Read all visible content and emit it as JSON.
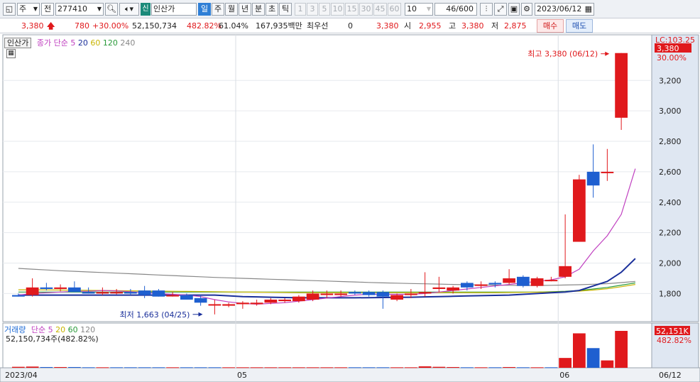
{
  "toolbar": {
    "market": "주",
    "kind": "전",
    "code": "277410",
    "label_badge": "신",
    "stock_name": "인산가",
    "periods": [
      "일",
      "주",
      "월",
      "년",
      "분",
      "초",
      "틱"
    ],
    "selected_period": "일",
    "intervals": [
      "1",
      "3",
      "5",
      "10",
      "15",
      "30",
      "45",
      "60"
    ],
    "interval_value": "10",
    "count": "46",
    "count_total": "/600",
    "date": "2023/06/12"
  },
  "quote": {
    "price": "3,380",
    "change": "780",
    "change_pct": "+30.00%",
    "volume": "52,150,734",
    "volume_ratio": "482.82%",
    "turnover": "61.04%",
    "amount": "167,935백만",
    "best_bid_label": "최우선",
    "best_bid": "0",
    "best_ask": "3,380",
    "open_label": "시",
    "open": "2,955",
    "high_label": "고",
    "high": "3,380",
    "low_label": "저",
    "low": "2,875",
    "buy": "매수",
    "sell": "매도"
  },
  "price_panel": {
    "name": "인산가",
    "legend_title": "종가 단순",
    "ma_periods": [
      "5",
      "20",
      "60",
      "120",
      "240"
    ],
    "ma_colors": [
      "#c040c0",
      "#1a2f9a",
      "#c8b400",
      "#2a9a3a",
      "#888888"
    ],
    "high_annotation": "최고 3,380 (06/12)",
    "low_annotation": "최저 1,663 (04/25)",
    "lc_label": "LC:103.25",
    "price_tag": "3,380",
    "pct_tag": "30.00%"
  },
  "volume_panel": {
    "name": "거래량",
    "legend_title": "단순",
    "ma_periods": [
      "5",
      "20",
      "60",
      "120"
    ],
    "summary": "52,150,734주(482.82%)",
    "volume_tag": "52,151K",
    "volume_pct": "482.82%"
  },
  "x_axis": {
    "labels": [
      "2023/04",
      "05",
      "06"
    ],
    "last_date": "06/12"
  },
  "chart_data": {
    "type": "candlestick",
    "price_axis": {
      "ticks": [
        1800,
        2000,
        2200,
        2400,
        2600,
        2800,
        3000,
        3200
      ],
      "ylim": [
        1620,
        3430
      ]
    },
    "candles": [
      {
        "o": 1790,
        "h": 1800,
        "l": 1780,
        "c": 1780
      },
      {
        "o": 1790,
        "h": 1900,
        "l": 1780,
        "c": 1840
      },
      {
        "o": 1840,
        "h": 1870,
        "l": 1820,
        "c": 1830
      },
      {
        "o": 1830,
        "h": 1860,
        "l": 1815,
        "c": 1840
      },
      {
        "o": 1840,
        "h": 1880,
        "l": 1810,
        "c": 1810
      },
      {
        "o": 1810,
        "h": 1840,
        "l": 1800,
        "c": 1800
      },
      {
        "o": 1800,
        "h": 1840,
        "l": 1790,
        "c": 1810
      },
      {
        "o": 1810,
        "h": 1830,
        "l": 1795,
        "c": 1810
      },
      {
        "o": 1810,
        "h": 1830,
        "l": 1790,
        "c": 1800
      },
      {
        "o": 1820,
        "h": 1850,
        "l": 1770,
        "c": 1790
      },
      {
        "o": 1820,
        "h": 1830,
        "l": 1780,
        "c": 1780
      },
      {
        "o": 1790,
        "h": 1810,
        "l": 1780,
        "c": 1790
      },
      {
        "o": 1790,
        "h": 1800,
        "l": 1760,
        "c": 1760
      },
      {
        "o": 1770,
        "h": 1790,
        "l": 1720,
        "c": 1740
      },
      {
        "o": 1730,
        "h": 1760,
        "l": 1663,
        "c": 1730
      },
      {
        "o": 1720,
        "h": 1740,
        "l": 1710,
        "c": 1730
      },
      {
        "o": 1730,
        "h": 1750,
        "l": 1700,
        "c": 1740
      },
      {
        "o": 1730,
        "h": 1760,
        "l": 1720,
        "c": 1740
      },
      {
        "o": 1740,
        "h": 1770,
        "l": 1730,
        "c": 1760
      },
      {
        "o": 1750,
        "h": 1770,
        "l": 1740,
        "c": 1760
      },
      {
        "o": 1750,
        "h": 1790,
        "l": 1740,
        "c": 1780
      },
      {
        "o": 1760,
        "h": 1820,
        "l": 1750,
        "c": 1800
      },
      {
        "o": 1790,
        "h": 1820,
        "l": 1770,
        "c": 1800
      },
      {
        "o": 1790,
        "h": 1820,
        "l": 1780,
        "c": 1800
      },
      {
        "o": 1810,
        "h": 1820,
        "l": 1790,
        "c": 1800
      },
      {
        "o": 1810,
        "h": 1820,
        "l": 1780,
        "c": 1790
      },
      {
        "o": 1810,
        "h": 1820,
        "l": 1700,
        "c": 1780
      },
      {
        "o": 1760,
        "h": 1800,
        "l": 1750,
        "c": 1790
      },
      {
        "o": 1790,
        "h": 1830,
        "l": 1770,
        "c": 1800
      },
      {
        "o": 1800,
        "h": 1940,
        "l": 1780,
        "c": 1810
      },
      {
        "o": 1830,
        "h": 1910,
        "l": 1810,
        "c": 1840
      },
      {
        "o": 1820,
        "h": 1850,
        "l": 1800,
        "c": 1840
      },
      {
        "o": 1870,
        "h": 1880,
        "l": 1820,
        "c": 1840
      },
      {
        "o": 1850,
        "h": 1880,
        "l": 1830,
        "c": 1860
      },
      {
        "o": 1870,
        "h": 1880,
        "l": 1840,
        "c": 1860
      },
      {
        "o": 1870,
        "h": 1960,
        "l": 1860,
        "c": 1900
      },
      {
        "o": 1910,
        "h": 1920,
        "l": 1840,
        "c": 1850
      },
      {
        "o": 1850,
        "h": 1910,
        "l": 1840,
        "c": 1900
      },
      {
        "o": 1890,
        "h": 1910,
        "l": 1880,
        "c": 1890
      },
      {
        "o": 1910,
        "h": 2320,
        "l": 1900,
        "c": 1980
      },
      {
        "o": 2140,
        "h": 2580,
        "l": 2140,
        "c": 2550
      },
      {
        "o": 2600,
        "h": 2780,
        "l": 2430,
        "c": 2510
      },
      {
        "o": 2600,
        "h": 2750,
        "l": 2540,
        "c": 2600
      },
      {
        "o": 2955,
        "h": 3380,
        "l": 2875,
        "c": 3380
      }
    ],
    "ma5": [
      1790,
      1800,
      1805,
      1810,
      1815,
      1815,
      1820,
      1818,
      1812,
      1805,
      1800,
      1795,
      1790,
      1780,
      1760,
      1745,
      1735,
      1730,
      1735,
      1740,
      1750,
      1760,
      1770,
      1780,
      1790,
      1795,
      1795,
      1795,
      1795,
      1800,
      1810,
      1820,
      1830,
      1840,
      1850,
      1860,
      1870,
      1880,
      1890,
      1910,
      1960,
      2080,
      2180,
      2320,
      2620
    ],
    "ma20": [
      1790,
      1790,
      1790,
      1790,
      1790,
      1790,
      1790,
      1790,
      1790,
      1790,
      1790,
      1790,
      1790,
      1790,
      1790,
      1785,
      1780,
      1778,
      1776,
      1774,
      1772,
      1772,
      1772,
      1772,
      1772,
      1773,
      1774,
      1775,
      1776,
      1778,
      1780,
      1782,
      1784,
      1786,
      1788,
      1790,
      1795,
      1800,
      1805,
      1810,
      1820,
      1850,
      1880,
      1940,
      2030
    ],
    "ma60": [
      1825,
      1825,
      1824,
      1823,
      1822,
      1821,
      1820,
      1819,
      1818,
      1817,
      1816,
      1815,
      1814,
      1813,
      1812,
      1811,
      1810,
      1809,
      1808,
      1807,
      1806,
      1806,
      1806,
      1806,
      1806,
      1806,
      1806,
      1806,
      1806,
      1806,
      1806,
      1806,
      1806,
      1806,
      1806,
      1807,
      1808,
      1809,
      1810,
      1812,
      1816,
      1823,
      1832,
      1845,
      1860
    ],
    "ma120": [
      1810,
      1810,
      1810,
      1810,
      1810,
      1810,
      1810,
      1810,
      1810,
      1810,
      1810,
      1810,
      1810,
      1810,
      1810,
      1810,
      1810,
      1810,
      1810,
      1810,
      1810,
      1810,
      1810,
      1810,
      1810,
      1810,
      1810,
      1810,
      1810,
      1810,
      1810,
      1810,
      1810,
      1810,
      1810,
      1810,
      1810,
      1810,
      1812,
      1815,
      1820,
      1830,
      1840,
      1855,
      1870
    ],
    "ma240": [
      1965,
      1960,
      1955,
      1950,
      1946,
      1942,
      1938,
      1934,
      1930,
      1926,
      1922,
      1918,
      1914,
      1910,
      1906,
      1903,
      1900,
      1897,
      1894,
      1891,
      1888,
      1885,
      1882,
      1879,
      1876,
      1873,
      1870,
      1868,
      1866,
      1864,
      1862,
      1860,
      1858,
      1856,
      1855,
      1854,
      1853,
      1853,
      1854,
      1856,
      1858,
      1861,
      1865,
      1872,
      1880
    ],
    "volume": [
      0.4,
      0.5,
      0.3,
      0.3,
      0.3,
      0.2,
      0.2,
      0.2,
      0.2,
      0.2,
      0.2,
      0.2,
      0.2,
      0.2,
      0.2,
      0.2,
      0.2,
      0.2,
      0.2,
      0.2,
      0.2,
      0.2,
      0.2,
      0.2,
      0.2,
      0.2,
      0.2,
      0.2,
      0.2,
      0.6,
      0.4,
      0.3,
      0.2,
      0.2,
      0.2,
      0.3,
      0.2,
      0.2,
      0.2,
      4,
      14,
      8,
      3,
      15
    ],
    "volume_up": [
      true,
      true,
      false,
      true,
      false,
      false,
      true,
      false,
      false,
      false,
      false,
      true,
      false,
      false,
      false,
      true,
      true,
      true,
      true,
      true,
      true,
      true,
      true,
      true,
      false,
      false,
      false,
      true,
      true,
      true,
      true,
      true,
      false,
      true,
      false,
      true,
      false,
      true,
      false,
      true,
      true,
      false,
      true,
      true
    ]
  }
}
